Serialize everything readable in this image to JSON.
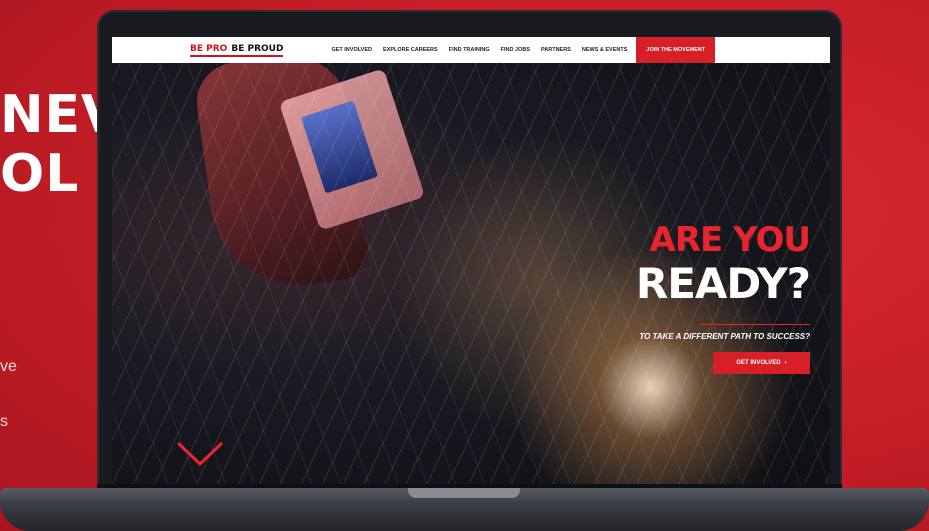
{
  "promo": {
    "headline_line1": "NEVER",
    "headline_line2": "OL",
    "copy_line1": "ve",
    "copy_line2": "s"
  },
  "site": {
    "logo_part1": "BE PRO",
    "logo_part2": "BE PROUD",
    "nav": [
      {
        "label": "GET INVOLVED"
      },
      {
        "label": "EXPLORE CAREERS"
      },
      {
        "label": "FIND TRAINING"
      },
      {
        "label": "FIND JOBS"
      },
      {
        "label": "PARTNERS"
      },
      {
        "label": "NEWS & EVENTS"
      }
    ],
    "nav_cta": "JOIN THE MOVEMENT",
    "hero_line1": "ARE YOU",
    "hero_line2": "READY?",
    "hero_sub": "TO TAKE A DIFFERENT PATH TO SUCCESS?",
    "hero_button": "GET INVOLVED",
    "hero_button_arrow": "›"
  },
  "colors": {
    "background_red": "#d0202a",
    "accent_red": "#d61f26"
  },
  "icons": {
    "scroll": "chevron-down-icon"
  }
}
